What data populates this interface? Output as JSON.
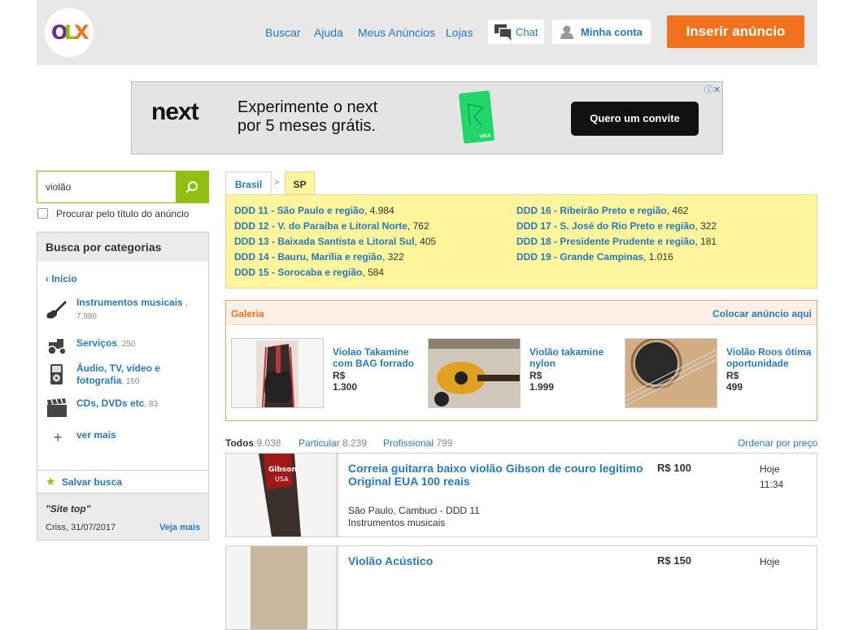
{
  "header": {
    "logo_letters": [
      "O",
      "L",
      "X"
    ],
    "nav": [
      "Buscar",
      "Ajuda",
      "Meus Anúncios",
      "Lojas"
    ],
    "chat_label": "Chat",
    "account_label": "Minha conta",
    "insert_label": "Inserir anúncio"
  },
  "ad": {
    "brand": "next",
    "line1": "Experimente o next",
    "line2": "por 5 meses grátis.",
    "card_label": "VISA",
    "cta": "Quero um convite"
  },
  "search": {
    "value": "violão",
    "title_only_label": "Procurar pelo título do anúncio"
  },
  "sidebar": {
    "heading": "Busca por categorias",
    "back_label": "Início",
    "categories": [
      {
        "name": "Instrumentos musicais",
        "count": "7.986",
        "icon": "guitar-icon"
      },
      {
        "name": "Serviços",
        "count": "250",
        "icon": "tractor-icon"
      },
      {
        "name": "Áudio, TV, vídeo e fotografia",
        "count": "150",
        "icon": "ipod-icon"
      },
      {
        "name": "CDs, DVDs etc",
        "count": "83",
        "icon": "clapperboard-icon"
      }
    ],
    "more_label": "ver mais",
    "save_label": "Salvar busca",
    "site_label": "\"Site top\"",
    "site_meta": "Criss, 31/07/2017",
    "see_more_label": "Veja mais"
  },
  "breadcrumb": {
    "country": "Brasil",
    "separator": ">",
    "state": "SP"
  },
  "regions": [
    {
      "name": "DDD 11 - São Paulo e região",
      "count": "4.984"
    },
    {
      "name": "DDD 12 - V. do Paraíba e Litoral Norte",
      "count": "762"
    },
    {
      "name": "DDD 13 - Baixada Santista e Litoral Sul",
      "count": "405"
    },
    {
      "name": "DDD 14 - Bauru, Marília e região",
      "count": "322"
    },
    {
      "name": "DDD 15 - Sorocaba e região",
      "count": "584"
    },
    {
      "name": "DDD 16 - Ribeirão Preto e região",
      "count": "462"
    },
    {
      "name": "DDD 17 - S. José do Rio Preto e região",
      "count": "322"
    },
    {
      "name": "DDD 18 - Presidente Prudente e região",
      "count": "181"
    },
    {
      "name": "DDD 19 - Grande Campinas",
      "count": "1.016"
    }
  ],
  "gallery": {
    "title": "Galeria",
    "place_ad_label": "Colocar anúncio aqui",
    "items": [
      {
        "title": "Violao Takamine com BAG forrado",
        "price": "R$ 1.300"
      },
      {
        "title": "Violão takamine nylon",
        "price": "R$ 1.999"
      },
      {
        "title": "Violão Roos ótima oportunidade",
        "price": "R$ 499"
      }
    ]
  },
  "filters": {
    "all_label": "Todos",
    "all_count": "9.038",
    "private_label": "Particular",
    "private_count": "8.239",
    "pro_label": "Profissional",
    "pro_count": "799",
    "sort_label": "Ordenar por preço"
  },
  "listings": [
    {
      "title": "Correia guitarra baixo violão Gibson de couro legitimo Original EUA 100 reais",
      "price": "R$ 100",
      "day": "Hoje",
      "time": "11:34",
      "location": "São Paulo, Cambuci - DDD 11",
      "category": "Instrumentos musicais"
    },
    {
      "title": "Violão Acústico",
      "price": "R$ 150",
      "day": "Hoje",
      "time": "",
      "location": "",
      "category": ""
    }
  ],
  "colors": {
    "brand_orange": "#f2711c",
    "search_green": "#8fbf10",
    "link_blue": "#2a79b5",
    "region_yellow": "#fff59d"
  }
}
